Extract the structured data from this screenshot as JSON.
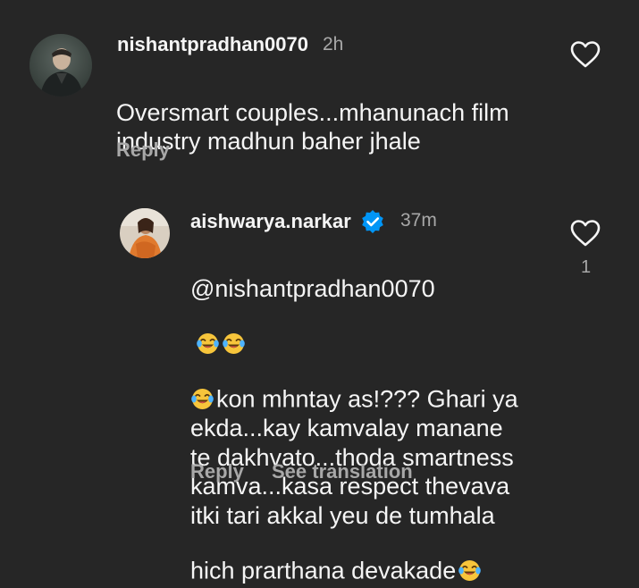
{
  "comment": {
    "username": "nishantpradhan0070",
    "time": "2h",
    "text": "Oversmart couples...mhanunach film industry madhun baher jhale",
    "reply_label": "Reply",
    "avatar_icon": "profile-photo"
  },
  "reply": {
    "username": "aishwarya.narkar",
    "verified": true,
    "time": "37m",
    "mention": "@nishantpradhan0070",
    "text_line1_after_emoji": "kon mhntay as!??? Ghari ya",
    "text_rest": "ekda...kay kamvalay manane\nte dakhvato...thoda smartness\nkamva...kasa respect thevava\nitki tari akkal yeu de  tumhala\nhich prarthana devakade",
    "emoji": "face-with-tears-of-joy",
    "like_count": "1",
    "reply_label": "Reply",
    "translate_label": "See translation",
    "avatar_icon": "profile-photo"
  },
  "colors": {
    "background": "#262626",
    "text": "#f5f5f5",
    "secondary": "#a8a8a8",
    "verified": "#0095f6",
    "emoji": "#f7c53b"
  }
}
